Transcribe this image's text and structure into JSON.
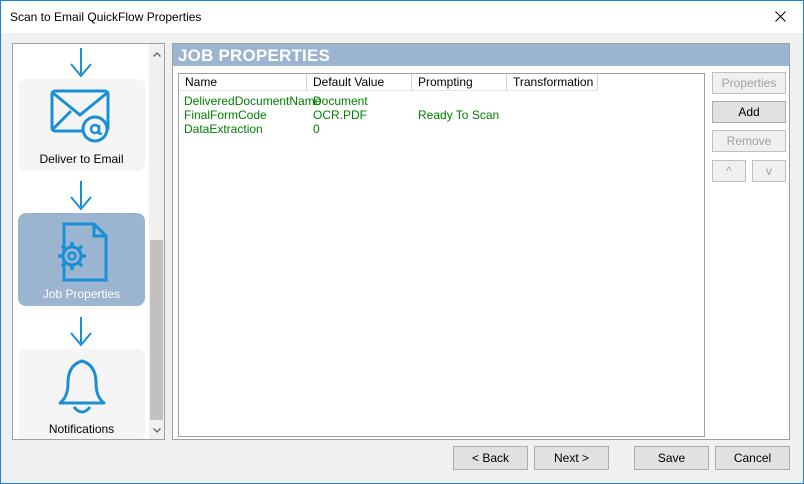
{
  "window": {
    "title": "Scan to Email QuickFlow Properties"
  },
  "steps": [
    {
      "label": "Deliver to Email",
      "icon": "envelope-at-icon",
      "selected": false
    },
    {
      "label": "Job Properties",
      "icon": "document-gear-icon",
      "selected": true
    },
    {
      "label": "Notifications",
      "icon": "bell-icon",
      "selected": false
    }
  ],
  "panel": {
    "title": "JOB PROPERTIES"
  },
  "table": {
    "columns": [
      "Name",
      "Default Value",
      "Prompting",
      "Transformation"
    ],
    "rows": [
      {
        "name": "DeliveredDocumentName",
        "default": "Document",
        "prompting": "",
        "transformation": ""
      },
      {
        "name": "FinalFormCode",
        "default": "OCR.PDF",
        "prompting": "Ready To Scan",
        "transformation": ""
      },
      {
        "name": "DataExtraction",
        "default": "0",
        "prompting": "",
        "transformation": ""
      }
    ]
  },
  "side_buttons": {
    "properties": "Properties",
    "add": "Add",
    "remove": "Remove",
    "up": "^",
    "down": "v"
  },
  "buttons": {
    "back": "< Back",
    "next": "Next >",
    "save": "Save",
    "cancel": "Cancel"
  },
  "colors": {
    "accent": "#1883d7",
    "selected_step": "#9bb4d0",
    "header": "#9bb4d0",
    "row_text": "#008000"
  }
}
